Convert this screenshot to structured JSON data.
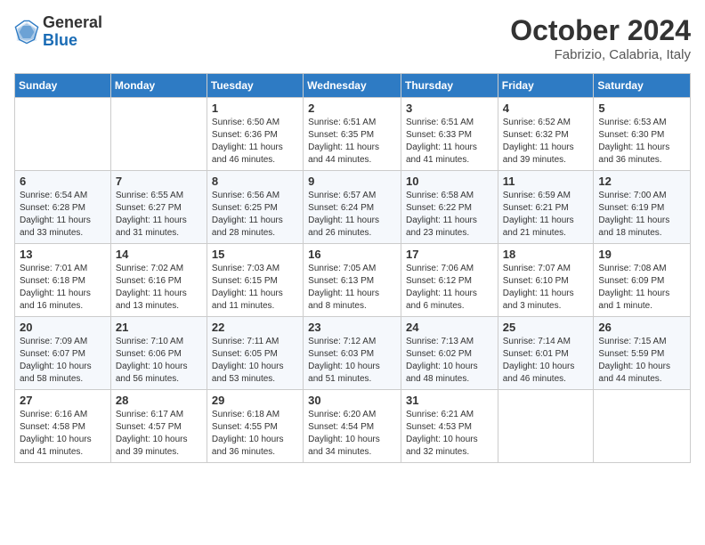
{
  "header": {
    "logo_general": "General",
    "logo_blue": "Blue",
    "month_title": "October 2024",
    "location": "Fabrizio, Calabria, Italy"
  },
  "weekdays": [
    "Sunday",
    "Monday",
    "Tuesday",
    "Wednesday",
    "Thursday",
    "Friday",
    "Saturday"
  ],
  "weeks": [
    [
      {
        "day": "",
        "info": ""
      },
      {
        "day": "",
        "info": ""
      },
      {
        "day": "1",
        "info": "Sunrise: 6:50 AM\nSunset: 6:36 PM\nDaylight: 11 hours and 46 minutes."
      },
      {
        "day": "2",
        "info": "Sunrise: 6:51 AM\nSunset: 6:35 PM\nDaylight: 11 hours and 44 minutes."
      },
      {
        "day": "3",
        "info": "Sunrise: 6:51 AM\nSunset: 6:33 PM\nDaylight: 11 hours and 41 minutes."
      },
      {
        "day": "4",
        "info": "Sunrise: 6:52 AM\nSunset: 6:32 PM\nDaylight: 11 hours and 39 minutes."
      },
      {
        "day": "5",
        "info": "Sunrise: 6:53 AM\nSunset: 6:30 PM\nDaylight: 11 hours and 36 minutes."
      }
    ],
    [
      {
        "day": "6",
        "info": "Sunrise: 6:54 AM\nSunset: 6:28 PM\nDaylight: 11 hours and 33 minutes."
      },
      {
        "day": "7",
        "info": "Sunrise: 6:55 AM\nSunset: 6:27 PM\nDaylight: 11 hours and 31 minutes."
      },
      {
        "day": "8",
        "info": "Sunrise: 6:56 AM\nSunset: 6:25 PM\nDaylight: 11 hours and 28 minutes."
      },
      {
        "day": "9",
        "info": "Sunrise: 6:57 AM\nSunset: 6:24 PM\nDaylight: 11 hours and 26 minutes."
      },
      {
        "day": "10",
        "info": "Sunrise: 6:58 AM\nSunset: 6:22 PM\nDaylight: 11 hours and 23 minutes."
      },
      {
        "day": "11",
        "info": "Sunrise: 6:59 AM\nSunset: 6:21 PM\nDaylight: 11 hours and 21 minutes."
      },
      {
        "day": "12",
        "info": "Sunrise: 7:00 AM\nSunset: 6:19 PM\nDaylight: 11 hours and 18 minutes."
      }
    ],
    [
      {
        "day": "13",
        "info": "Sunrise: 7:01 AM\nSunset: 6:18 PM\nDaylight: 11 hours and 16 minutes."
      },
      {
        "day": "14",
        "info": "Sunrise: 7:02 AM\nSunset: 6:16 PM\nDaylight: 11 hours and 13 minutes."
      },
      {
        "day": "15",
        "info": "Sunrise: 7:03 AM\nSunset: 6:15 PM\nDaylight: 11 hours and 11 minutes."
      },
      {
        "day": "16",
        "info": "Sunrise: 7:05 AM\nSunset: 6:13 PM\nDaylight: 11 hours and 8 minutes."
      },
      {
        "day": "17",
        "info": "Sunrise: 7:06 AM\nSunset: 6:12 PM\nDaylight: 11 hours and 6 minutes."
      },
      {
        "day": "18",
        "info": "Sunrise: 7:07 AM\nSunset: 6:10 PM\nDaylight: 11 hours and 3 minutes."
      },
      {
        "day": "19",
        "info": "Sunrise: 7:08 AM\nSunset: 6:09 PM\nDaylight: 11 hours and 1 minute."
      }
    ],
    [
      {
        "day": "20",
        "info": "Sunrise: 7:09 AM\nSunset: 6:07 PM\nDaylight: 10 hours and 58 minutes."
      },
      {
        "day": "21",
        "info": "Sunrise: 7:10 AM\nSunset: 6:06 PM\nDaylight: 10 hours and 56 minutes."
      },
      {
        "day": "22",
        "info": "Sunrise: 7:11 AM\nSunset: 6:05 PM\nDaylight: 10 hours and 53 minutes."
      },
      {
        "day": "23",
        "info": "Sunrise: 7:12 AM\nSunset: 6:03 PM\nDaylight: 10 hours and 51 minutes."
      },
      {
        "day": "24",
        "info": "Sunrise: 7:13 AM\nSunset: 6:02 PM\nDaylight: 10 hours and 48 minutes."
      },
      {
        "day": "25",
        "info": "Sunrise: 7:14 AM\nSunset: 6:01 PM\nDaylight: 10 hours and 46 minutes."
      },
      {
        "day": "26",
        "info": "Sunrise: 7:15 AM\nSunset: 5:59 PM\nDaylight: 10 hours and 44 minutes."
      }
    ],
    [
      {
        "day": "27",
        "info": "Sunrise: 6:16 AM\nSunset: 4:58 PM\nDaylight: 10 hours and 41 minutes."
      },
      {
        "day": "28",
        "info": "Sunrise: 6:17 AM\nSunset: 4:57 PM\nDaylight: 10 hours and 39 minutes."
      },
      {
        "day": "29",
        "info": "Sunrise: 6:18 AM\nSunset: 4:55 PM\nDaylight: 10 hours and 36 minutes."
      },
      {
        "day": "30",
        "info": "Sunrise: 6:20 AM\nSunset: 4:54 PM\nDaylight: 10 hours and 34 minutes."
      },
      {
        "day": "31",
        "info": "Sunrise: 6:21 AM\nSunset: 4:53 PM\nDaylight: 10 hours and 32 minutes."
      },
      {
        "day": "",
        "info": ""
      },
      {
        "day": "",
        "info": ""
      }
    ]
  ]
}
